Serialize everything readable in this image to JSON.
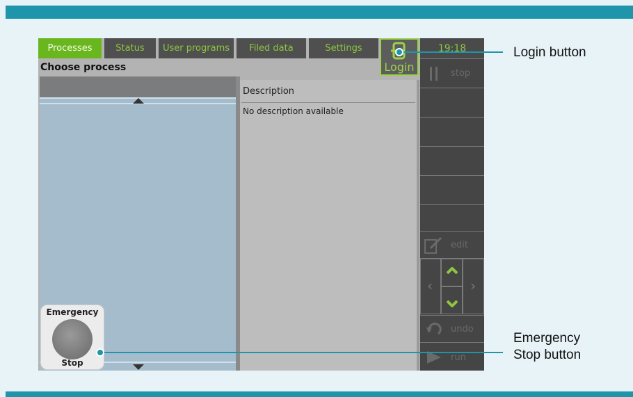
{
  "tabs": [
    {
      "label": "Processes",
      "active": true
    },
    {
      "label": "Status",
      "active": false
    },
    {
      "label": "User programs",
      "active": false
    },
    {
      "label": "Filed data",
      "active": false
    },
    {
      "label": "Settings",
      "active": false
    }
  ],
  "login": {
    "label": "Login"
  },
  "clock": "19:18",
  "page_title": "Choose process",
  "description": {
    "title": "Description",
    "text": "No description available"
  },
  "emergency": {
    "top_label": "Emergency",
    "bottom_label": "Stop"
  },
  "sidebar": {
    "stop_label": "stop",
    "edit_label": "edit",
    "undo_label": "undo",
    "run_label": "run"
  },
  "callouts": {
    "login": "Login button",
    "estop_line1": "Emergency",
    "estop_line2": "Stop button"
  },
  "colors": {
    "accent_green": "#8ec63f",
    "active_tab": "#6ab61f",
    "callout_blue": "#1f95ab"
  }
}
